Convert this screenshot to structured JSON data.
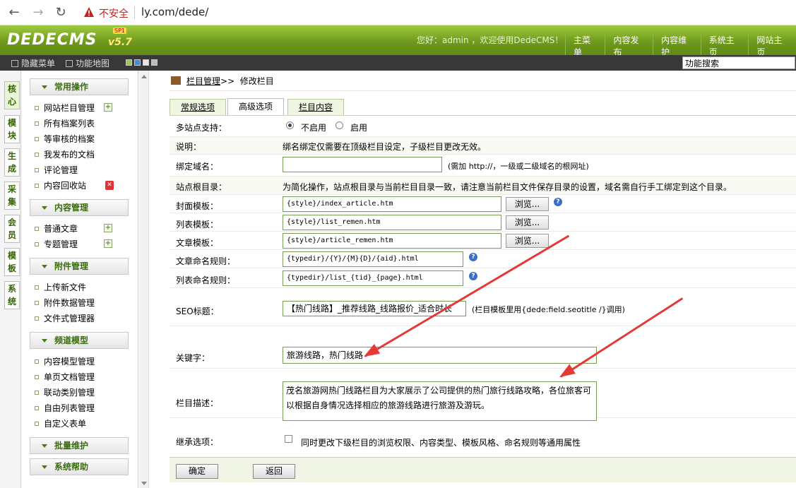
{
  "browser": {
    "insecure_label": "不安全",
    "url": "ly.com/dede/"
  },
  "header": {
    "logo": "DEDECMS",
    "version": "v5.7",
    "edition": "SP1",
    "welcome": "您好：admin ，欢迎使用DedeCMS！",
    "menu": [
      "主菜单",
      "内容发布",
      "内容维护",
      "系统主页",
      "网站主页"
    ]
  },
  "toolbar": {
    "hide_menu": "隐藏菜单",
    "site_map": "功能地图",
    "search_value": "功能搜索"
  },
  "vtabs": [
    {
      "label": "核心"
    },
    {
      "label": "模块"
    },
    {
      "label": "生成"
    },
    {
      "label": "采集"
    },
    {
      "label": "会员"
    },
    {
      "label": "模板"
    },
    {
      "label": "系统"
    }
  ],
  "sidebar": {
    "sections": [
      {
        "title": "常用操作",
        "items": [
          "网站栏目管理",
          "所有档案列表",
          "等审核的档案",
          "我发布的文档",
          "评论管理",
          "内容回收站"
        ]
      },
      {
        "title": "内容管理",
        "items": [
          "普通文章",
          "专题管理"
        ]
      },
      {
        "title": "附件管理",
        "items": [
          "上传新文件",
          "附件数据管理",
          "文件式管理器"
        ]
      },
      {
        "title": "频道模型",
        "items": [
          "内容模型管理",
          "单页文档管理",
          "联动类别管理",
          "自由列表管理",
          "自定义表单"
        ]
      },
      {
        "title": "批量维护",
        "items": []
      },
      {
        "title": "系统帮助",
        "items": []
      }
    ]
  },
  "breadcrumb": {
    "parent": "栏目管理",
    "sep": ">>",
    "current": "修改栏目"
  },
  "tabs": [
    "常规选项",
    "高级选项",
    "栏目内容"
  ],
  "form": {
    "multisite": {
      "label": "多站点支持：",
      "opt_off": "不启用",
      "opt_on": "启用"
    },
    "explain": {
      "label": "说明：",
      "text": "绑名绑定仅需要在顶级栏目设定，子级栏目更改无效。"
    },
    "domain": {
      "label": "绑定域名：",
      "value": "",
      "hint": "(需加 http://，一级或二级域名的根网址)"
    },
    "siteroot": {
      "label": "站点根目录：",
      "text": "为简化操作，站点根目录与当前栏目目录一致，请注意当前栏目文件保存目录的设置，域名需自行手工绑定到这个目录。"
    },
    "cover_tpl": {
      "label": "封面模板：",
      "value": "{style}/index_article.htm",
      "browse": "浏览..."
    },
    "list_tpl": {
      "label": "列表模板：",
      "value": "{style}/list_remen.htm",
      "browse": "浏览..."
    },
    "article_tpl": {
      "label": "文章模板：",
      "value": "{style}/article_remen.htm",
      "browse": "浏览..."
    },
    "article_rule": {
      "label": "文章命名规则：",
      "value": "{typedir}/{Y}/{M}{D}/{aid}.html"
    },
    "list_rule": {
      "label": "列表命名规则：",
      "value": "{typedir}/list_{tid}_{page}.html"
    },
    "seo_title": {
      "label": "SEO标题：",
      "value": "【热门线路】_推荐线路_线路报价_适合时长",
      "hint": "(栏目模板里用{dede:field.seotitle /}调用)"
    },
    "keywords": {
      "label": "关键字：",
      "value": "旅游线路，热门线路"
    },
    "description": {
      "label": "栏目描述：",
      "value": "茂名旅游网热门线路栏目为大家展示了公司提供的热门旅行线路攻略，各位旅客可以根据自身情况选择相应的旅游线路进行旅游及游玩。"
    },
    "inherit": {
      "label": "继承选项：",
      "text": "同时更改下级栏目的浏览权限、内容类型、模板风格、命名规则等通用属性"
    }
  },
  "buttons": {
    "ok": "确定",
    "back": "返回"
  },
  "colors": {
    "header_green": "#6f9a1d",
    "annotation_red": "#e53935"
  }
}
